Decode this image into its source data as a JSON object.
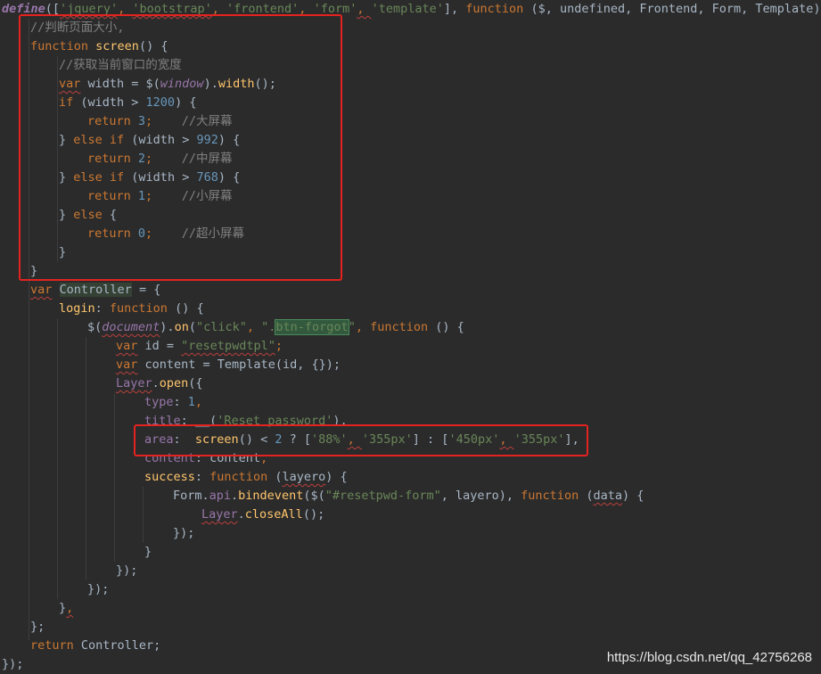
{
  "code": {
    "line01": {
      "define": "define",
      "open": "([",
      "q1": "'jquery'",
      "c1": ", ",
      "q2": "'bootstrap'",
      "c2": ", ",
      "q3": "'frontend'",
      "c3": ", ",
      "q4": "'form'",
      "c4": ", ",
      "q5": "'template'",
      "close": "], ",
      "function": "function",
      "params": " ($, undefined, Frontend, Form, Template) {"
    },
    "line02": "//判断页面大小,",
    "line03": {
      "kw": "function",
      "name": " screen",
      "rest": "() {"
    },
    "line04": "//获取当前窗口的宽度",
    "line05": {
      "var": "var",
      "a": " width = $(",
      "window": "window",
      "b": ").",
      "width": "width",
      "c": "();"
    },
    "line06": {
      "if": "if",
      "a": " (width > ",
      "n": "1200",
      "b": ") {"
    },
    "line07": {
      "ret": "return",
      "n": " 3",
      "semi": ";",
      "cmt": "    //大屏幕"
    },
    "line08": {
      "a": "} ",
      "else": "else if",
      "b": " (width > ",
      "n": "992",
      "c": ") {"
    },
    "line09": {
      "ret": "return",
      "n": " 2",
      "semi": ";",
      "cmt": "    //中屏幕"
    },
    "line10": {
      "a": "} ",
      "else": "else if",
      "b": " (width > ",
      "n": "768",
      "c": ") {"
    },
    "line11": {
      "ret": "return",
      "n": " 1",
      "semi": ";",
      "cmt": "    //小屏幕"
    },
    "line12": {
      "a": "} ",
      "else": "else",
      "b": " {"
    },
    "line13": {
      "ret": "return",
      "n": " 0",
      "semi": ";",
      "cmt": "    //超小屏幕"
    },
    "line14": "}",
    "line15": "}",
    "line16": {
      "var": "var",
      "sp": " ",
      "name": "Controller",
      "rest": " = {"
    },
    "line17": {
      "name": "login",
      "colon": ": ",
      "fn": "function",
      "rest": " () {"
    },
    "line18": {
      "a": "$(",
      "doc": "document",
      "b": ").",
      "on": "on",
      "c": "(",
      "s1": "\"click\"",
      "d": ", ",
      "s2a": "\".",
      "s2b": "btn-forgot",
      "s2c": "\"",
      "e": ", ",
      "fn": "function",
      "f": " () {"
    },
    "line19": {
      "var": "var",
      "a": " id = ",
      "s": "\"resetpwdtpl\"",
      "b": ";"
    },
    "line20": {
      "var": "var",
      "a": " content = Template(id, {});"
    },
    "line21": {
      "layer": "Layer",
      "dot": ".",
      "open": "open",
      "rest": "({"
    },
    "line22": {
      "key": "type",
      "colon": ": ",
      "n": "1",
      "c": ","
    },
    "line23": {
      "key": "title",
      "colon": ": ",
      "a": "__(",
      "s": "'Reset password'",
      "b": "),"
    },
    "line24": {
      "key": "area",
      "colon": ":  ",
      "fn": "screen",
      "a": "() < ",
      "n": "2",
      "b": " ? [",
      "s1": "'88%'",
      "c1": ", ",
      "s2": "'355px'",
      "c2": "] : [",
      "s3": "'450px'",
      "c3": ", ",
      "s4": "'355px'",
      "end": "],"
    },
    "line25": {
      "key": "content",
      "colon": ": ",
      "a": "content",
      "b": ","
    },
    "line26": {
      "key": "success",
      "colon": ": ",
      "fn": "function",
      "a": " (",
      "p": "layero",
      "b": ") {"
    },
    "line27": {
      "a": "Form.",
      "api": "api",
      "dot": ".",
      "bind": "bindevent",
      "b": "($(",
      "s": "\"#resetpwd-form\"",
      "c": ", layero), ",
      "fn": "function",
      "d": " (",
      "p": "data",
      "e": ") {"
    },
    "line28": {
      "layer": "Layer",
      "dot": ".",
      "close": "closeAll",
      "rest": "();"
    },
    "line29": "});",
    "line30": "}",
    "line31": "});",
    "line32": "});",
    "line33": {
      "a": "}",
      "comma": ","
    },
    "line34": "};",
    "line35": {
      "ret": "return",
      "rest": " Controller;"
    },
    "line36": "});"
  },
  "watermark": "https://blog.csdn.net/qq_42756268",
  "colors": {
    "background": "#2b2b2b",
    "keyword": "#cc7832",
    "string": "#6a8759",
    "number": "#6897bb",
    "comment": "#808080",
    "function": "#ffc66d",
    "global": "#9876aa",
    "annotation_box": "#e3231f"
  }
}
